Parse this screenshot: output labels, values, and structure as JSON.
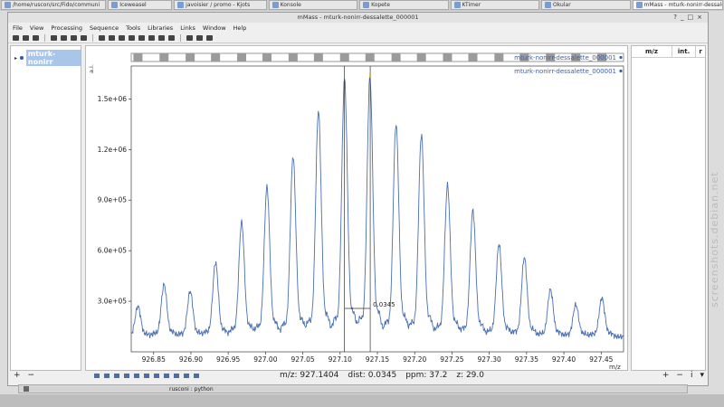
{
  "taskbar": [
    {
      "label": "/home/ruscon/src/Fido/communi",
      "active": false
    },
    {
      "label": "Iceweasel",
      "active": false
    },
    {
      "label": "javoisier / promo - Kjots",
      "active": false
    },
    {
      "label": "Konsole",
      "active": false
    },
    {
      "label": "Kopete",
      "active": false
    },
    {
      "label": "KTimer",
      "active": false
    },
    {
      "label": "Okular",
      "active": false
    },
    {
      "label": "mMass - mturk-nonirr-dessale",
      "active": true
    }
  ],
  "window": {
    "title": "mMass - mturk-nonirr-dessalette_000001",
    "controls": [
      "?",
      "_",
      "□",
      "×"
    ]
  },
  "menu": [
    "File",
    "View",
    "Processing",
    "Sequence",
    "Tools",
    "Libraries",
    "Links",
    "Window",
    "Help"
  ],
  "tree": {
    "item": "mturk-nonirr"
  },
  "peaklist": {
    "headers": [
      "m/z",
      "int.",
      "r"
    ]
  },
  "plot": {
    "doc_label": "mturk-nonirr-dessalette_000001",
    "legend": "mturk-nonirr-dessalette_000001",
    "ylabel": "a.i.",
    "xlabel": "m/z",
    "distance_label": "0.0345",
    "distance_value": 0.0345,
    "cursor_mz": [
      927.1059,
      927.1404
    ],
    "line_color": "#4a6fb0"
  },
  "status": {
    "mz": "m/z: 927.1404",
    "dist": "dist: 0.0345",
    "ppm": "ppm: 37.2",
    "z": "z: 29.0"
  },
  "dock": {
    "label": "rusconi : python"
  },
  "watermark": "screenshots.debian.net",
  "chart_data": {
    "type": "line",
    "xlabel": "m/z",
    "ylabel": "a.i.",
    "xlim": [
      926.82,
      927.48
    ],
    "ylim": [
      0,
      1620000
    ],
    "xticks": [
      "926.85",
      "926.90",
      "926.95",
      "927.00",
      "927.05",
      "927.10",
      "927.15",
      "927.20",
      "927.25",
      "927.30",
      "927.35",
      "927.40",
      "927.45"
    ],
    "yticks": [
      "3.0e+05",
      "6.0e+05",
      "9.0e+05",
      "1.2e+06",
      "1.5e+06"
    ],
    "series": [
      {
        "name": "mturk-nonirr-dessalette_000001",
        "peaks_x": [
          926.829,
          926.864,
          926.899,
          926.933,
          926.968,
          927.002,
          927.037,
          927.071,
          927.106,
          927.14,
          927.175,
          927.209,
          927.244,
          927.278,
          927.313,
          927.347,
          927.382,
          927.416,
          927.451
        ],
        "peaks_y": [
          180000,
          310000,
          270000,
          440000,
          680000,
          890000,
          1070000,
          1340000,
          1530000,
          1540000,
          1260000,
          1200000,
          900000,
          750000,
          550000,
          470000,
          280000,
          190000,
          230000
        ],
        "baseline": 90000
      }
    ]
  }
}
